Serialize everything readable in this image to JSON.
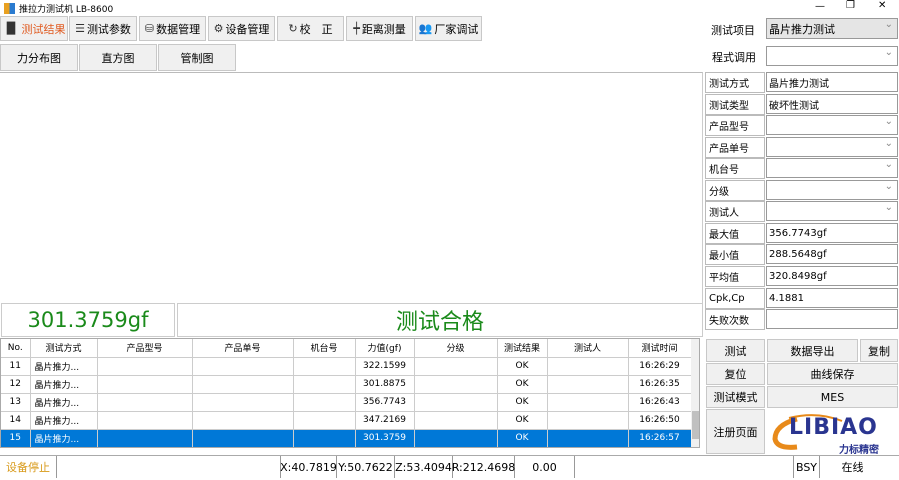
{
  "window": {
    "title": "推拉力测试机 LB-8600",
    "controls": [
      "—",
      "❐",
      "✕"
    ]
  },
  "toolbar": [
    {
      "label": "测试结果",
      "icon": "bar-chart-icon",
      "active": true
    },
    {
      "label": "测试参数",
      "icon": "sliders-icon"
    },
    {
      "label": "数据管理",
      "icon": "database-icon"
    },
    {
      "label": "设备管理",
      "icon": "gears-icon"
    },
    {
      "label": "校　正",
      "icon": "refresh-icon"
    },
    {
      "label": "距离测量",
      "icon": "distance-icon"
    },
    {
      "label": "厂家调试",
      "icon": "users-icon"
    }
  ],
  "subtabs": [
    "力分布图",
    "直方图",
    "管制图"
  ],
  "result": {
    "value": "301.3759gf",
    "status": "测试合格",
    "color": "#1a8a1a"
  },
  "table": {
    "headers": [
      "No.",
      "测试方式",
      "产品型号",
      "产品单号",
      "机台号",
      "力值(gf)",
      "分级",
      "测试结果",
      "测试人",
      "测试时间"
    ],
    "rows": [
      [
        "11",
        "晶片推力...",
        "",
        "",
        "",
        "322.1599",
        "",
        "OK",
        "",
        "16:26:29"
      ],
      [
        "12",
        "晶片推力...",
        "",
        "",
        "",
        "301.8875",
        "",
        "OK",
        "",
        "16:26:35"
      ],
      [
        "13",
        "晶片推力...",
        "",
        "",
        "",
        "356.7743",
        "",
        "OK",
        "",
        "16:26:43"
      ],
      [
        "14",
        "晶片推力...",
        "",
        "",
        "",
        "347.2169",
        "",
        "OK",
        "",
        "16:26:50"
      ],
      [
        "15",
        "晶片推力...",
        "",
        "",
        "",
        "301.3759",
        "",
        "OK",
        "",
        "16:26:57"
      ]
    ],
    "selected_row": 4
  },
  "right": {
    "test_item_label": "测试项目",
    "test_item_value": "晶片推力测试",
    "program_label": "程式调用",
    "program_value": "",
    "fields": [
      {
        "label": "测试方式",
        "value": "晶片推力测试",
        "dropdown": false
      },
      {
        "label": "测试类型",
        "value": "破坏性测试",
        "dropdown": false
      },
      {
        "label": "产品型号",
        "value": "",
        "dropdown": true
      },
      {
        "label": "产品单号",
        "value": "",
        "dropdown": true
      },
      {
        "label": "机台号",
        "value": "",
        "dropdown": true
      },
      {
        "label": "分级",
        "value": "",
        "dropdown": true
      },
      {
        "label": "测试人",
        "value": "",
        "dropdown": true
      },
      {
        "label": "最大值",
        "value": "356.7743gf",
        "dropdown": false
      },
      {
        "label": "最小值",
        "value": "288.5648gf",
        "dropdown": false
      },
      {
        "label": "平均值",
        "value": "320.8498gf",
        "dropdown": false
      },
      {
        "label": "Cpk,Cp",
        "value": "4.1881",
        "dropdown": false
      },
      {
        "label": "失败次数",
        "value": "",
        "dropdown": false
      }
    ]
  },
  "buttons": {
    "test": "测试",
    "export": "数据导出",
    "copy": "复制",
    "reset": "复位",
    "save_curve": "曲线保存",
    "test_mode": "测试模式",
    "mes": "MES",
    "register": "注册页面"
  },
  "logo": {
    "text": "LIBIAO",
    "subtext": "力标精密"
  },
  "status": {
    "device": "设备停止",
    "x": "X:40.7819",
    "y": "Y:50.7622",
    "z": "Z:53.4094",
    "r": "R:212.4698",
    "value": "0.00",
    "bsy": "BSY",
    "online": "在线"
  }
}
